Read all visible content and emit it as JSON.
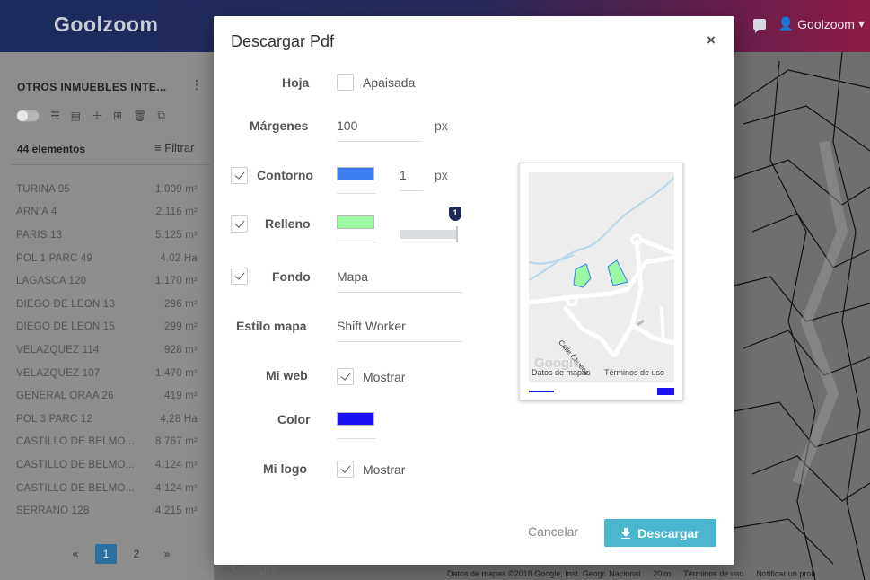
{
  "app": {
    "brand": "Goolzoom",
    "user_label": "Goolzoom"
  },
  "sidebar": {
    "title": "OTROS INMUEBLES INTE...",
    "count": "44 elementos",
    "filter_label": "Filtrar",
    "items": [
      {
        "name": "TURINA 95",
        "area": "1.009 m²"
      },
      {
        "name": "ARNIA 4",
        "area": "2.116 m²"
      },
      {
        "name": "PARIS 13",
        "area": "5.125 m²"
      },
      {
        "name": "POL 1 PARC 49",
        "area": "4.02 Ha"
      },
      {
        "name": "LAGASCA 120",
        "area": "1.170 m²"
      },
      {
        "name": "DIEGO DE LEON 13",
        "area": "296 m²"
      },
      {
        "name": "DIEGO DE LEON 15",
        "area": "299 m²"
      },
      {
        "name": "VELAZQUEZ 114",
        "area": "928 m²"
      },
      {
        "name": "VELAZQUEZ 107",
        "area": "1.470 m²"
      },
      {
        "name": "GENERAL ORAA 26",
        "area": "419 m²"
      },
      {
        "name": "POL 3 PARC 12",
        "area": "4,28 Ha"
      },
      {
        "name": "CASTILLO DE BELMO...",
        "area": "8.767 m²"
      },
      {
        "name": "CASTILLO DE BELMO...",
        "area": "4.124 m²"
      },
      {
        "name": "CASTILLO DE BELMO...",
        "area": "4.124 m²"
      },
      {
        "name": "SERRANO 128",
        "area": "4.215 m²"
      }
    ],
    "pager": {
      "prev": "«",
      "pages": [
        "1",
        "2"
      ],
      "active": "1",
      "next": "»"
    }
  },
  "map": {
    "footer_data": "Datos de mapas ©2018 Google, Inst. Geogr. Nacional",
    "footer_scale": "20 m",
    "footer_terms": "Términos de uso",
    "footer_report": "Notificar un prob",
    "google": "Google"
  },
  "dialog": {
    "title": "Descargar Pdf",
    "close": "×",
    "sheet": {
      "label": "Hoja",
      "option": "Apaisada",
      "checked": false
    },
    "margins": {
      "label": "Márgenes",
      "value": "100",
      "unit": "px"
    },
    "outline": {
      "label": "Contorno",
      "checked": true,
      "color": "#3b7ded",
      "width": "1",
      "unit": "px"
    },
    "fill": {
      "label": "Relleno",
      "checked": true,
      "color": "#9cf9a3",
      "opacity_tooltip": "1",
      "opacity_fraction": 1
    },
    "background": {
      "label": "Fondo",
      "checked": true,
      "value": "Mapa"
    },
    "map_style": {
      "label": "Estilo mapa",
      "value": "Shift Worker"
    },
    "my_web": {
      "label": "Mi web",
      "option": "Mostrar",
      "checked": true
    },
    "color": {
      "label": "Color",
      "value": "#1a10f2"
    },
    "my_logo": {
      "label": "Mi logo",
      "option": "Mostrar",
      "checked": true
    },
    "preview": {
      "street": "Calle Chueca",
      "map_data": "Datos de mapas",
      "terms": "Términos de uso",
      "google": "Google"
    },
    "cancel": "Cancelar",
    "download": "Descargar"
  }
}
